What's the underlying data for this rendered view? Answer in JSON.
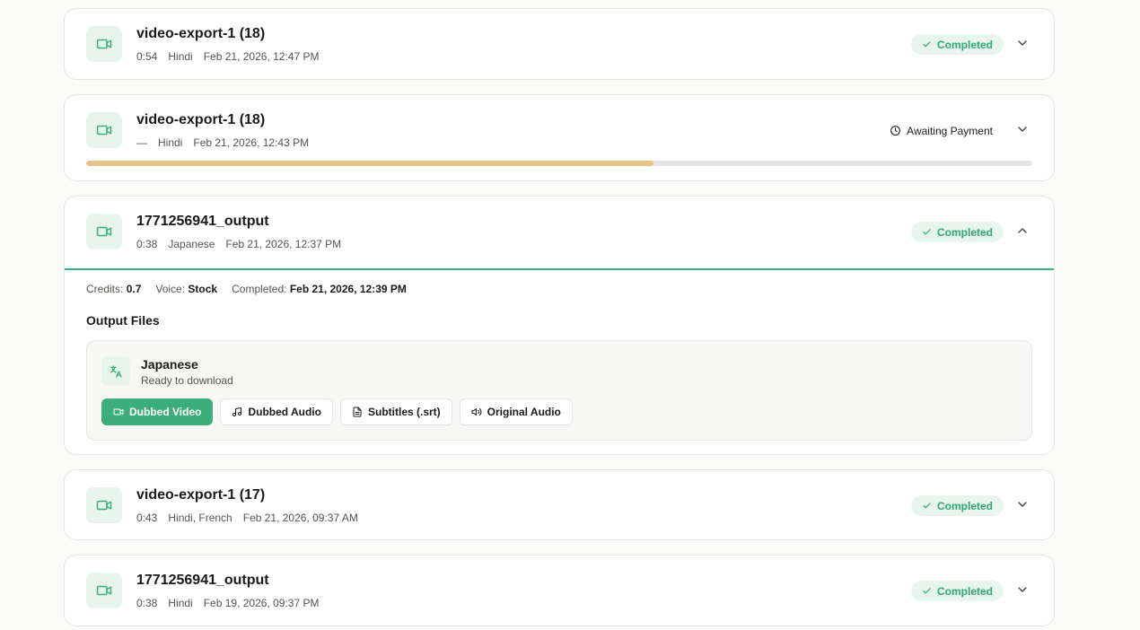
{
  "jobs": [
    {
      "title": "video-export-1 (18)",
      "duration": "0:54",
      "languages": "Hindi",
      "date": "Feb 21, 2026, 12:47 PM",
      "status": "Completed"
    },
    {
      "title": "video-export-1 (18)",
      "duration": "—",
      "languages": "Hindi",
      "date": "Feb 21, 2026, 12:43 PM",
      "status": "Awaiting Payment",
      "progress": 0.6
    },
    {
      "title": "1771256941_output",
      "duration": "0:38",
      "languages": "Japanese",
      "date": "Feb 21, 2026, 12:37 PM",
      "status": "Completed",
      "expanded": true,
      "details": {
        "credits_label": "Credits:",
        "credits_value": "0.7",
        "voice_label": "Voice:",
        "voice_value": "Stock",
        "completed_label": "Completed:",
        "completed_value": "Feb 21, 2026, 12:39 PM",
        "output_files_title": "Output Files",
        "file": {
          "language": "Japanese",
          "status": "Ready to download",
          "buttons": {
            "dubbed_video": "Dubbed Video",
            "dubbed_audio": "Dubbed Audio",
            "subtitles": "Subtitles (.srt)",
            "original_audio": "Original Audio"
          }
        }
      }
    },
    {
      "title": "video-export-1 (17)",
      "duration": "0:43",
      "languages": "Hindi, French",
      "date": "Feb 21, 2026, 09:37 AM",
      "status": "Completed"
    },
    {
      "title": "1771256941_output",
      "duration": "0:38",
      "languages": "Hindi",
      "date": "Feb 19, 2026, 09:37 PM",
      "status": "Completed"
    }
  ],
  "icons": {
    "thumbnail": "video-icon",
    "completed": "check-icon",
    "awaiting": "clock-icon",
    "expand": "chevron-down-icon",
    "collapse": "chevron-up-icon",
    "language": "translate-icon",
    "dubbed_audio": "music-note-icon",
    "subtitles": "document-icon",
    "original_audio": "speaker-icon"
  },
  "colors": {
    "accent": "#3bae7b",
    "accent_light": "#e8f5ef",
    "progress": "#e8c48a"
  }
}
